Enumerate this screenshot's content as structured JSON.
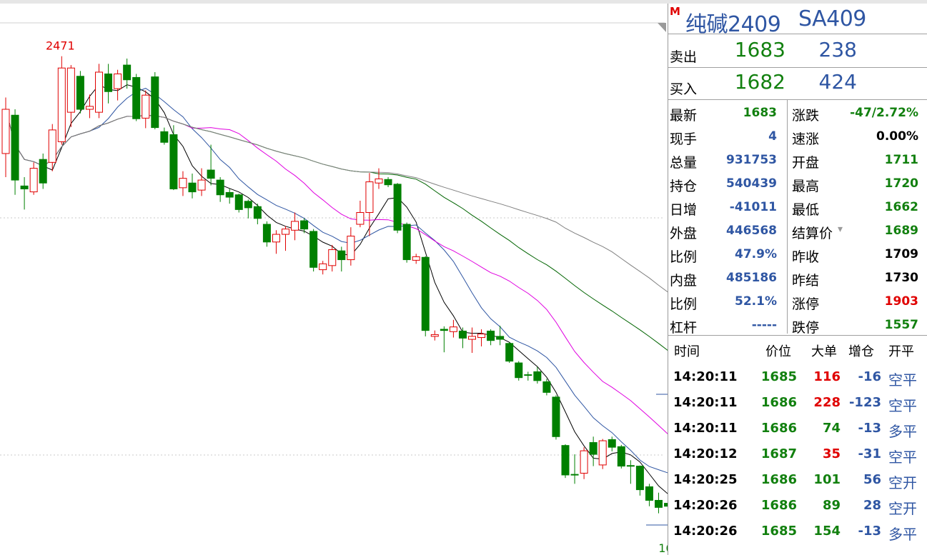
{
  "chart_data": {
    "type": "candlestick",
    "high_label": "2471",
    "low_label": "1662",
    "candles": [
      {
        "o": 2310,
        "c": 2385,
        "h": 2405,
        "l": 2270
      },
      {
        "o": 2375,
        "c": 2265,
        "h": 2385,
        "l": 2240
      },
      {
        "o": 2255,
        "c": 2250,
        "h": 2270,
        "l": 2215
      },
      {
        "o": 2245,
        "c": 2285,
        "h": 2295,
        "l": 2240
      },
      {
        "o": 2300,
        "c": 2260,
        "h": 2310,
        "l": 2250
      },
      {
        "o": 2295,
        "c": 2350,
        "h": 2360,
        "l": 2280
      },
      {
        "o": 2330,
        "c": 2455,
        "h": 2475,
        "l": 2325
      },
      {
        "o": 2380,
        "c": 2455,
        "h": 2460,
        "l": 2355
      },
      {
        "o": 2441,
        "c": 2385,
        "h": 2450,
        "l": 2378
      },
      {
        "o": 2385,
        "c": 2390,
        "h": 2410,
        "l": 2370
      },
      {
        "o": 2380,
        "c": 2448,
        "h": 2462,
        "l": 2370
      },
      {
        "o": 2445,
        "c": 2415,
        "h": 2462,
        "l": 2395
      },
      {
        "o": 2420,
        "c": 2445,
        "h": 2452,
        "l": 2400
      },
      {
        "o": 2460,
        "c": 2435,
        "h": 2471,
        "l": 2420
      },
      {
        "o": 2439,
        "c": 2369,
        "h": 2445,
        "l": 2365
      },
      {
        "o": 2370,
        "c": 2409,
        "h": 2417,
        "l": 2353
      },
      {
        "o": 2440,
        "c": 2354,
        "h": 2448,
        "l": 2351
      },
      {
        "o": 2347,
        "c": 2329,
        "h": 2354,
        "l": 2325
      },
      {
        "o": 2342,
        "c": 2250,
        "h": 2358,
        "l": 2248
      },
      {
        "o": 2252,
        "c": 2268,
        "h": 2280,
        "l": 2238
      },
      {
        "o": 2260,
        "c": 2245,
        "h": 2276,
        "l": 2234
      },
      {
        "o": 2248,
        "c": 2265,
        "h": 2285,
        "l": 2238
      },
      {
        "o": 2282,
        "c": 2268,
        "h": 2325,
        "l": 2256
      },
      {
        "o": 2265,
        "c": 2240,
        "h": 2270,
        "l": 2228
      },
      {
        "o": 2244,
        "c": 2236,
        "h": 2250,
        "l": 2225
      },
      {
        "o": 2240,
        "c": 2215,
        "h": 2242,
        "l": 2210
      },
      {
        "o": 2229,
        "c": 2218,
        "h": 2232,
        "l": 2200
      },
      {
        "o": 2220,
        "c": 2200,
        "h": 2225,
        "l": 2190
      },
      {
        "o": 2190,
        "c": 2160,
        "h": 2195,
        "l": 2152
      },
      {
        "o": 2160,
        "c": 2173,
        "h": 2180,
        "l": 2140
      },
      {
        "o": 2173,
        "c": 2182,
        "h": 2187,
        "l": 2145
      },
      {
        "o": 2180,
        "c": 2195,
        "h": 2210,
        "l": 2163
      },
      {
        "o": 2196,
        "c": 2182,
        "h": 2200,
        "l": 2175
      },
      {
        "o": 2178,
        "c": 2117,
        "h": 2182,
        "l": 2110
      },
      {
        "o": 2113,
        "c": 2123,
        "h": 2128,
        "l": 2105
      },
      {
        "o": 2120,
        "c": 2147,
        "h": 2155,
        "l": 2110
      },
      {
        "o": 2145,
        "c": 2130,
        "h": 2152,
        "l": 2110
      },
      {
        "o": 2130,
        "c": 2170,
        "h": 2185,
        "l": 2120
      },
      {
        "o": 2190,
        "c": 2210,
        "h": 2230,
        "l": 2185
      },
      {
        "o": 2210,
        "c": 2262,
        "h": 2277,
        "l": 2170
      },
      {
        "o": 2260,
        "c": 2267,
        "h": 2285,
        "l": 2250
      },
      {
        "o": 2266,
        "c": 2257,
        "h": 2270,
        "l": 2253
      },
      {
        "o": 2258,
        "c": 2180,
        "h": 2260,
        "l": 2175
      },
      {
        "o": 2190,
        "c": 2130,
        "h": 2193,
        "l": 2125
      },
      {
        "o": 2129,
        "c": 2135,
        "h": 2140,
        "l": 2123
      },
      {
        "o": 2134,
        "c": 2010,
        "h": 2136,
        "l": 2000
      },
      {
        "o": 2000,
        "c": 2003,
        "h": 2010,
        "l": 1993
      },
      {
        "o": 2012,
        "c": 2010,
        "h": 2017,
        "l": 1973
      },
      {
        "o": 2008,
        "c": 2016,
        "h": 2028,
        "l": 1998
      },
      {
        "o": 2009,
        "c": 1997,
        "h": 2015,
        "l": 1980
      },
      {
        "o": 1995,
        "c": 2000,
        "h": 2015,
        "l": 1972
      },
      {
        "o": 1998,
        "c": 2004,
        "h": 2012,
        "l": 1983
      },
      {
        "o": 2009,
        "c": 1993,
        "h": 2012,
        "l": 1985
      },
      {
        "o": 2000,
        "c": 1995,
        "h": 2018,
        "l": 1985
      },
      {
        "o": 1988,
        "c": 1958,
        "h": 1990,
        "l": 1955
      },
      {
        "o": 1955,
        "c": 1930,
        "h": 1958,
        "l": 1925
      },
      {
        "o": 1935,
        "c": 1935,
        "h": 1940,
        "l": 1925
      },
      {
        "o": 1940,
        "c": 1925,
        "h": 1948,
        "l": 1920
      },
      {
        "o": 1923,
        "c": 1905,
        "h": 1928,
        "l": 1900
      },
      {
        "o": 1897,
        "c": 1830,
        "h": 1900,
        "l": 1825
      },
      {
        "o": 1815,
        "c": 1765,
        "h": 1817,
        "l": 1760
      },
      {
        "o": 1766,
        "c": 1766,
        "h": 1800,
        "l": 1750
      },
      {
        "o": 1768,
        "c": 1806,
        "h": 1812,
        "l": 1758
      },
      {
        "o": 1820,
        "c": 1800,
        "h": 1830,
        "l": 1780
      },
      {
        "o": 1782,
        "c": 1823,
        "h": 1826,
        "l": 1775
      },
      {
        "o": 1825,
        "c": 1812,
        "h": 1830,
        "l": 1805
      },
      {
        "o": 1813,
        "c": 1780,
        "h": 1816,
        "l": 1776
      },
      {
        "o": 1781,
        "c": 1780,
        "h": 1790,
        "l": 1750
      },
      {
        "o": 1780,
        "c": 1740,
        "h": 1781,
        "l": 1730
      },
      {
        "o": 1745,
        "c": 1722,
        "h": 1750,
        "l": 1712
      },
      {
        "o": 1722,
        "c": 1710,
        "h": 1735,
        "l": 1700
      },
      {
        "o": 1717,
        "c": 1712,
        "h": 1721,
        "l": 1700
      },
      {
        "o": 1710,
        "c": 1685,
        "h": 1715,
        "l": 1662
      }
    ]
  },
  "quote": {
    "m_badge": "M",
    "name": "纯碱2409",
    "code": "SA409",
    "sell_label": "卖出",
    "sell_price": "1683",
    "sell_vol": "238",
    "buy_label": "买入",
    "buy_price": "1682",
    "buy_vol": "424"
  },
  "stats": {
    "left": [
      {
        "label": "最新",
        "value": "1683",
        "color": "#12800f"
      },
      {
        "label": "现手",
        "value": "4",
        "color": "#2f56a3"
      },
      {
        "label": "总量",
        "value": "931753",
        "color": "#2f56a3"
      },
      {
        "label": "持仓",
        "value": "540439",
        "color": "#2f56a3"
      },
      {
        "label": "日增",
        "value": "-41011",
        "color": "#2f56a3"
      },
      {
        "label": "外盘",
        "value": "446568",
        "color": "#2f56a3"
      },
      {
        "label": "比例",
        "value": "47.9%",
        "color": "#2f56a3"
      },
      {
        "label": "内盘",
        "value": "485186",
        "color": "#2f56a3"
      },
      {
        "label": "比例",
        "value": "52.1%",
        "color": "#2f56a3"
      },
      {
        "label": "杠杆",
        "value": "-----",
        "color": "#2f56a3"
      }
    ],
    "right": [
      {
        "label": "涨跌",
        "value": "-47/2.72%",
        "color": "#12800f"
      },
      {
        "label": "速涨",
        "value": "0.00%",
        "color": "#000000"
      },
      {
        "label": "开盘",
        "value": "1711",
        "color": "#12800f"
      },
      {
        "label": "最高",
        "value": "1720",
        "color": "#12800f"
      },
      {
        "label": "最低",
        "value": "1662",
        "color": "#12800f"
      },
      {
        "label": "结算价",
        "value": "1689",
        "color": "#12800f"
      },
      {
        "label": "昨收",
        "value": "1709",
        "color": "#000000"
      },
      {
        "label": "昨结",
        "value": "1730",
        "color": "#000000"
      },
      {
        "label": "涨停",
        "value": "1903",
        "color": "#e00000"
      },
      {
        "label": "跌停",
        "value": "1557",
        "color": "#12800f"
      }
    ]
  },
  "ticks": {
    "headers": [
      "时间",
      "价位",
      "大单",
      "增仓",
      "开平"
    ],
    "rows": [
      {
        "time": "14:20:11",
        "price": "1685",
        "vol": "116",
        "vol_color": "#e00000",
        "oi": "-16",
        "oc": "空平"
      },
      {
        "time": "14:20:11",
        "price": "1686",
        "vol": "228",
        "vol_color": "#e00000",
        "oi": "-123",
        "oc": "空平"
      },
      {
        "time": "14:20:11",
        "price": "1686",
        "vol": "74",
        "vol_color": "#12800f",
        "oi": "-13",
        "oc": "多平"
      },
      {
        "time": "14:20:12",
        "price": "1687",
        "vol": "35",
        "vol_color": "#e00000",
        "oi": "-31",
        "oc": "空平"
      },
      {
        "time": "14:20:25",
        "price": "1686",
        "vol": "101",
        "vol_color": "#12800f",
        "oi": "56",
        "oc": "空开"
      },
      {
        "time": "14:20:26",
        "price": "1686",
        "vol": "89",
        "vol_color": "#12800f",
        "oi": "28",
        "oc": "空开"
      },
      {
        "time": "14:20:26",
        "price": "1685",
        "vol": "154",
        "vol_color": "#12800f",
        "oi": "-13",
        "oc": "多平"
      }
    ]
  },
  "colors": {
    "up": "#e00000",
    "down": "#008000",
    "ma5": "#000000",
    "ma10": "#2f56a3",
    "ma20": "#e000e0",
    "ma40": "#006400",
    "ma60": "#808080",
    "price_green": "#12800f",
    "blue": "#2f56a3"
  }
}
